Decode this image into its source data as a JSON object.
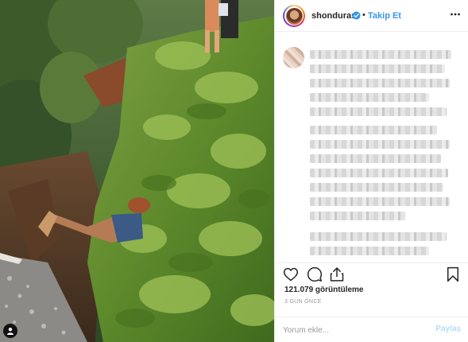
{
  "post": {
    "username": "shonduras",
    "separator": "•",
    "follow_label": "Takip Et",
    "views": "121.079 görüntüleme",
    "time_ago": "3 GÜN ÖNCE",
    "comment_placeholder": "Yorum ekle...",
    "share_label": "Paylaş"
  },
  "icons": {
    "verified": "verified-badge-icon",
    "more": "more-options-icon",
    "like": "heart-icon",
    "comment": "comment-icon",
    "share": "share-icon",
    "save": "bookmark-icon",
    "tagged": "user-tag-icon"
  },
  "colors": {
    "accent": "#3897f0",
    "text": "#262626",
    "muted": "#999999",
    "share_disabled": "#b2dffc"
  }
}
